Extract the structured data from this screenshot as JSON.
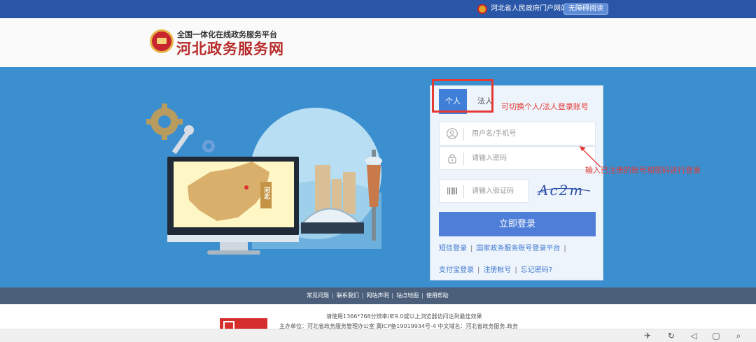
{
  "topbar": {
    "gov_link": "河北省人民政府门户网站",
    "accessibility_button": "无障碍阅读"
  },
  "header": {
    "slogan": "全国一体化在线政务服务平台",
    "site_name": "河北政务服务网"
  },
  "banner": {
    "map_label": "河北"
  },
  "login": {
    "tabs": [
      {
        "label": "个人",
        "active": true
      },
      {
        "label": "法人",
        "active": false
      }
    ],
    "username_placeholder": "用户名/手机号",
    "password_placeholder": "请输入密码",
    "captcha_placeholder": "请输入验证码",
    "captcha_text": "Ac2m",
    "submit_label": "立即登录",
    "links_row1": [
      "短信登录",
      "国家政务服务账号登录平台"
    ],
    "links_row2": [
      "支付宝登录",
      "注册帐号",
      "忘记密码?"
    ]
  },
  "annotations": {
    "switch_hint": "可切换个人/法人登录账号",
    "input_hint": "输入已注册的账号和密码进行登录",
    "color": "#e53935"
  },
  "footer_nav": [
    "常见问题",
    "联系我们",
    "网站声明",
    "站点地图",
    "使用帮助"
  ],
  "footer": {
    "line1": "请使用1366*768分辨率/IE9.0或以上浏览器访问达到最佳效果",
    "line2": "主办单位：河北省政务服务管理办公室    冀ICP备19019934号-4    中文域名：河北省政务服务.政务"
  },
  "colors": {
    "topbar": "#2a56a8",
    "banner": "#3b8fcf",
    "primary_button": "#4f7ed9",
    "footer_nav": "#4b5f7b"
  }
}
